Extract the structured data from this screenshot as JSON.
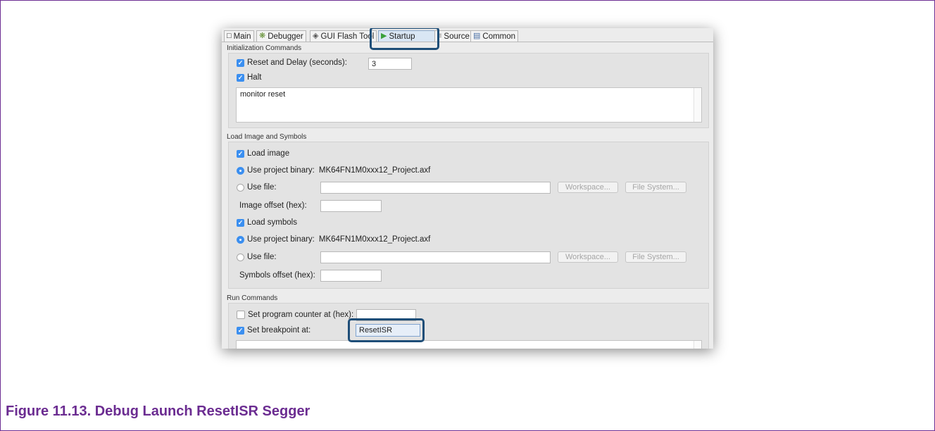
{
  "tabs": [
    {
      "label": "Main",
      "icon": "page-icon"
    },
    {
      "label": "Debugger",
      "icon": "debugger-icon"
    },
    {
      "label": "GUI Flash Tool",
      "icon": "flash-tool-icon"
    },
    {
      "label": "Startup",
      "icon": "startup-play-icon"
    },
    {
      "label": "Source",
      "icon": "source-icon"
    },
    {
      "label": "Common",
      "icon": "common-icon"
    }
  ],
  "init": {
    "section_label": "Initialization Commands",
    "reset_delay_label": "Reset and Delay (seconds):",
    "reset_delay_value": "3",
    "halt_label": "Halt",
    "commands_text": "monitor reset"
  },
  "load": {
    "section_label": "Load Image and Symbols",
    "load_image_label": "Load image",
    "use_project_binary_label": "Use project binary:",
    "project_binary": "MK64FN1M0xxx12_Project.axf",
    "use_file_label": "Use file:",
    "workspace_label": "Workspace...",
    "file_system_label": "File System...",
    "image_offset_label": "Image offset (hex):",
    "load_symbols_label": "Load symbols",
    "symbols_offset_label": "Symbols offset (hex):"
  },
  "run": {
    "section_label": "Run Commands",
    "set_pc_label": "Set program counter at (hex):",
    "set_breakpoint_label": "Set breakpoint at:",
    "breakpoint_value": "ResetISR"
  },
  "caption": "Figure 11.13. Debug Launch ResetISR Segger",
  "colors": {
    "caption": "#6b2c91",
    "highlight": "#1e4e78",
    "checkbox": "#3b8ff0"
  }
}
